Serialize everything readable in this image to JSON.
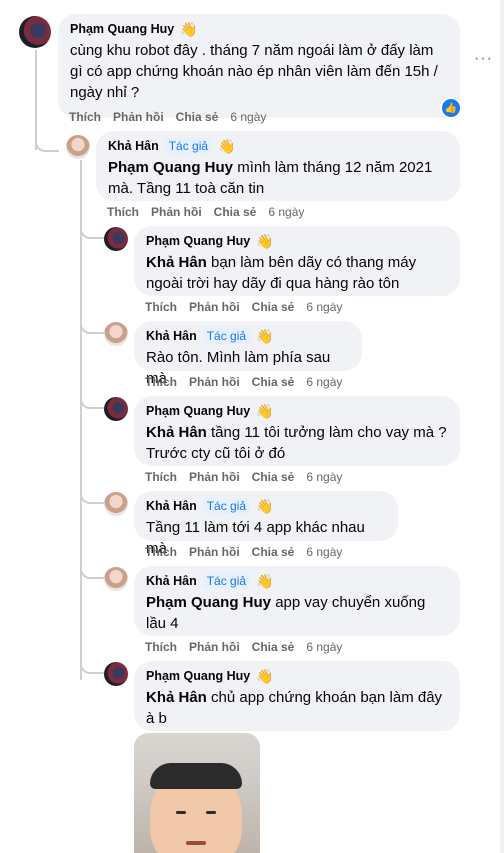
{
  "comments": [
    {
      "author": "Phạm Quang Huy",
      "badge": "",
      "mention": "",
      "text": "cùng khu robot đây . tháng 7 năm ngoái làm ở đấy làm gì có app chứng khoán nào ép nhân viên làm đến 15h / ngày nhỉ ?",
      "like": "Thích",
      "reply": "Phản hồi",
      "share": "Chia sẻ",
      "time": "6 ngày"
    },
    {
      "author": "Khả Hân",
      "badge": "Tác giả",
      "mention": "Phạm Quang Huy",
      "text": " mình làm tháng 12 năm 2021 mà. Tầng 11 toà căn tin",
      "like": "Thích",
      "reply": "Phản hồi",
      "share": "Chia sẻ",
      "time": "6 ngày"
    },
    {
      "author": "Phạm Quang Huy",
      "badge": "",
      "mention": "Khả Hân",
      "text": " bạn làm bên dãy có thang máy ngoài trời hay dãy đi qua hàng rào tôn",
      "like": "Thích",
      "reply": "Phản hồi",
      "share": "Chia sẻ",
      "time": "6 ngày"
    },
    {
      "author": "Khả Hân",
      "badge": "Tác giả",
      "mention": "",
      "text": "Rào tôn. Mình làm phía sau mà",
      "like": "Thích",
      "reply": "Phản hồi",
      "share": "Chia sẻ",
      "time": "6 ngày"
    },
    {
      "author": "Phạm Quang Huy",
      "badge": "",
      "mention": "Khả Hân",
      "text": " tầng 11 tôi tưởng làm cho vay mà ? Trước cty cũ tôi ở đó",
      "like": "Thích",
      "reply": "Phản hồi",
      "share": "Chia sẻ",
      "time": "6 ngày"
    },
    {
      "author": "Khả Hân",
      "badge": "Tác giả",
      "mention": "",
      "text": "Tầng 11 làm tới 4 app khác nhau mà",
      "like": "Thích",
      "reply": "Phản hồi",
      "share": "Chia sẻ",
      "time": "6 ngày"
    },
    {
      "author": "Khả Hân",
      "badge": "Tác giả",
      "mention": "Phạm Quang Huy",
      "text": " app vay chuyển xuống lầu 4",
      "like": "Thích",
      "reply": "Phản hồi",
      "share": "Chia sẻ",
      "time": "6 ngày"
    },
    {
      "author": "Phạm Quang Huy",
      "badge": "",
      "mention": "Khả Hân",
      "text": " chủ app chứng khoán bạn làm đây à b",
      "like": "",
      "reply": "",
      "share": "",
      "time": ""
    }
  ],
  "icons": {
    "wave": "waving-hand-icon",
    "like": "thumbs-up-icon",
    "more": "more-dots-icon"
  },
  "colors": {
    "bubble": "#f0f2f5",
    "badge_text": "#1877f2",
    "meta": "#65676b"
  }
}
